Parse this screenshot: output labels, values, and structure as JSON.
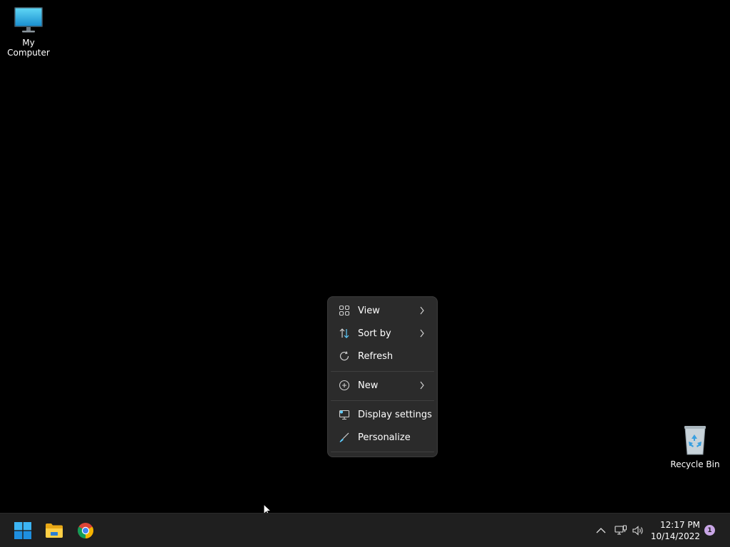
{
  "desktop": {
    "icons": [
      {
        "label": "My Computer",
        "icon": "monitor-icon"
      },
      {
        "label": "Recycle Bin",
        "icon": "recycle-bin-icon"
      }
    ]
  },
  "context_menu": {
    "items": [
      {
        "label": "View",
        "icon": "grid-icon",
        "submenu": true
      },
      {
        "label": "Sort by",
        "icon": "sort-icon",
        "submenu": true
      },
      {
        "label": "Refresh",
        "icon": "refresh-icon",
        "submenu": false
      },
      {
        "label": "New",
        "icon": "plus-circle-icon",
        "submenu": true
      },
      {
        "label": "Display settings",
        "icon": "display-icon",
        "submenu": false
      },
      {
        "label": "Personalize",
        "icon": "brush-icon",
        "submenu": false
      }
    ]
  },
  "taskbar": {
    "apps": [
      {
        "name": "Start",
        "icon": "windows-start-icon"
      },
      {
        "name": "File Explorer",
        "icon": "folder-icon"
      },
      {
        "name": "Chrome",
        "icon": "chrome-icon"
      }
    ],
    "clock": {
      "time": "12:17 PM",
      "date": "10/14/2022"
    },
    "notification_count": "1"
  },
  "colors": {
    "desktop_bg": "#000000",
    "menu_bg": "#2b2b2b",
    "taskbar_bg": "#1f1f1f",
    "accent": "#60cdff",
    "notification_badge": "#c9a6e6"
  }
}
